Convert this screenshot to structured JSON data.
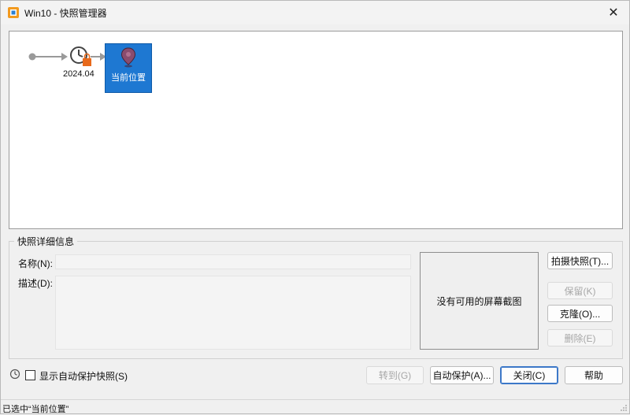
{
  "window": {
    "title": "Win10 - 快照管理器",
    "close_symbol": "✕"
  },
  "tree": {
    "snapshots": [
      {
        "label": "2024.04",
        "icon": "clock-lock-icon"
      }
    ],
    "current": {
      "label": "当前位置",
      "icon": "location-pin-icon",
      "selected": true
    },
    "colors": {
      "selection": "#1e78d2",
      "connector": "#9a9a9a",
      "lock": "#e86a1c"
    }
  },
  "details": {
    "group_title": "快照详细信息",
    "name_label": "名称(N):",
    "name_value": "",
    "description_label": "描述(D):",
    "description_value": "",
    "no_screenshot": "没有可用的屏幕截图"
  },
  "side_buttons": {
    "take_snapshot": "拍摄快照(T)...",
    "keep": "保留(K)",
    "clone": "克隆(O)...",
    "delete": "删除(E)"
  },
  "bottom": {
    "show_autosave_label": "显示自动保护快照(S)",
    "show_autosave_checked": false,
    "goto": "转到(G)",
    "autoprotect": "自动保护(A)...",
    "close": "关闭(C)",
    "help": "帮助"
  },
  "status": {
    "text": "已选中“当前位置”"
  }
}
